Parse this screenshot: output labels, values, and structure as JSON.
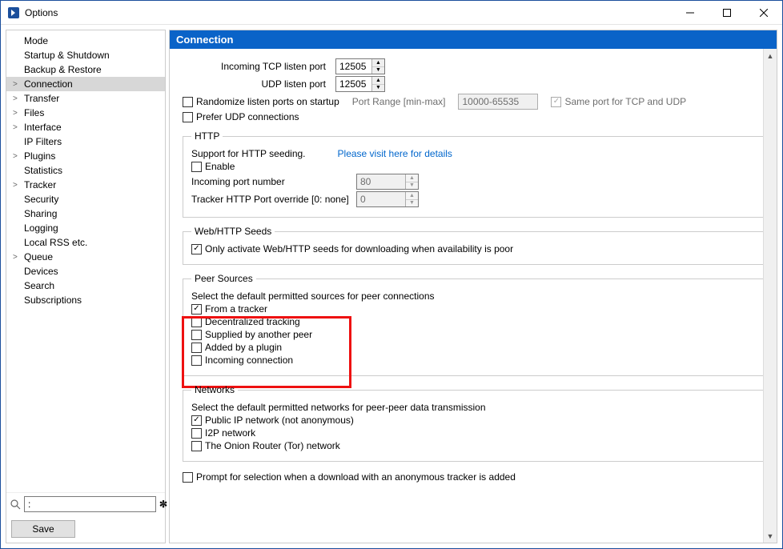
{
  "window": {
    "title": "Options"
  },
  "nav": {
    "items": [
      {
        "label": "Mode",
        "exp": false
      },
      {
        "label": "Startup & Shutdown",
        "exp": false
      },
      {
        "label": "Backup & Restore",
        "exp": false
      },
      {
        "label": "Connection",
        "exp": true,
        "selected": true
      },
      {
        "label": "Transfer",
        "exp": true
      },
      {
        "label": "Files",
        "exp": true
      },
      {
        "label": "Interface",
        "exp": true
      },
      {
        "label": "IP Filters",
        "exp": false
      },
      {
        "label": "Plugins",
        "exp": true
      },
      {
        "label": "Statistics",
        "exp": false
      },
      {
        "label": "Tracker",
        "exp": true
      },
      {
        "label": "Security",
        "exp": false
      },
      {
        "label": "Sharing",
        "exp": false
      },
      {
        "label": "Logging",
        "exp": false
      },
      {
        "label": "Local RSS etc.",
        "exp": false
      },
      {
        "label": "Queue",
        "exp": true
      },
      {
        "label": "Devices",
        "exp": false
      },
      {
        "label": "Search",
        "exp": false
      },
      {
        "label": "Subscriptions",
        "exp": false
      }
    ],
    "search_value": ":",
    "save": "Save"
  },
  "header": "Connection",
  "ports": {
    "tcp_label": "Incoming TCP listen port",
    "tcp_value": "12505",
    "udp_label": "UDP listen port",
    "udp_value": "12505"
  },
  "randomize": {
    "label": "Randomize listen ports on startup",
    "range_label": "Port Range [min-max]",
    "range_value": "10000-65535",
    "same_port": "Same port for TCP and UDP"
  },
  "prefer_udp": "Prefer UDP connections",
  "http": {
    "legend": "HTTP",
    "support": "Support for HTTP seeding.",
    "link": "Please visit here for details",
    "enable": "Enable",
    "inc_port_label": "Incoming port number",
    "inc_port_value": "80",
    "override_label": "Tracker HTTP Port override [0: none]",
    "override_value": "0"
  },
  "webseeds": {
    "legend": "Web/HTTP Seeds",
    "only": "Only activate Web/HTTP seeds for downloading when availability is poor"
  },
  "peer_sources": {
    "legend": "Peer Sources",
    "desc": "Select the default permitted sources for peer connections",
    "items": [
      {
        "label": "From a tracker",
        "checked": true
      },
      {
        "label": "Decentralized tracking",
        "checked": false
      },
      {
        "label": "Supplied by another peer",
        "checked": false
      },
      {
        "label": "Added by a plugin",
        "checked": false
      },
      {
        "label": "Incoming connection",
        "checked": false
      }
    ]
  },
  "networks": {
    "legend": "Networks",
    "desc": "Select the default permitted networks for peer-peer data transmission",
    "items": [
      {
        "label": "Public IP network (not anonymous)",
        "checked": true
      },
      {
        "label": "I2P network",
        "checked": false
      },
      {
        "label": "The Onion Router (Tor) network",
        "checked": false
      }
    ]
  },
  "prompt": "Prompt for selection when a download with an anonymous tracker is added"
}
